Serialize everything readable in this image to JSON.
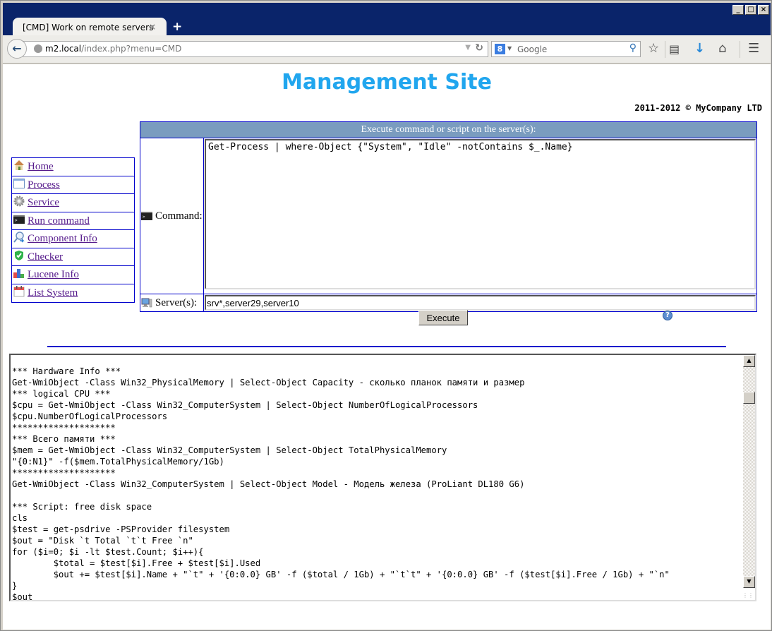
{
  "browser": {
    "tab_title": "[CMD] Work on remote servers",
    "tab_close": "×",
    "new_tab": "+",
    "url_host": "m2.local",
    "url_path": "/index.php?menu=CMD",
    "search_engine_letter": "8",
    "search_placeholder": "Google",
    "window_controls": {
      "minimize": "_",
      "maximize": "□",
      "close": "×"
    }
  },
  "header": {
    "title": "Management Site",
    "copyright": "2011-2012 © MyCompany LTD"
  },
  "sidebar": {
    "items": [
      {
        "label": "Home",
        "icon": "home-icon"
      },
      {
        "label": "Process",
        "icon": "window-icon"
      },
      {
        "label": "Service",
        "icon": "gear-icon"
      },
      {
        "label": "Run command",
        "icon": "terminal-icon"
      },
      {
        "label": "Component Info",
        "icon": "magnifier-icon"
      },
      {
        "label": "Checker",
        "icon": "shield-check-icon"
      },
      {
        "label": "Lucene Info",
        "icon": "bar-chart-icon"
      },
      {
        "label": "List System",
        "icon": "calendar-icon"
      }
    ]
  },
  "form": {
    "header": "Execute command or script on the server(s):",
    "command_label": "Command:",
    "command_value": "Get-Process | where-Object {\"System\", \"Idle\" -notContains $_.Name}",
    "servers_label": "Server(s):",
    "servers_value": "srv*,server29,server10",
    "execute_label": "Execute",
    "help_glyph": "?"
  },
  "output": {
    "text": "*** Hardware Info ***\nGet-WmiObject -Class Win32_PhysicalMemory | Select-Object Capacity - сколько планок памяти и размер\n*** logical CPU ***\n$cpu = Get-WmiObject -Class Win32_ComputerSystem | Select-Object NumberOfLogicalProcessors\n$cpu.NumberOfLogicalProcessors\n********************\n*** Всего памяти ***\n$mem = Get-WmiObject -Class Win32_ComputerSystem | Select-Object TotalPhysicalMemory\n\"{0:N1}\" -f($mem.TotalPhysicalMemory/1Gb)\n********************\nGet-WmiObject -Class Win32_ComputerSystem | Select-Object Model - Модель железа (ProLiant DL180 G6)\n\n*** Script: free disk space\ncls\n$test = get-psdrive -PSProvider filesystem\n$out = \"Disk `t Total `t`t Free `n\"\nfor ($i=0; $i -lt $test.Count; $i++){\n        $total = $test[$i].Free + $test[$i].Used\n        $out += $test[$i].Name + \"`t\" + '{0:0.0} GB' -f ($total / 1Gb) + \"`t`t\" + '{0:0.0} GB' -f ($test[$i].Free / 1Gb) + \"`n\"\n}\n$out"
  }
}
